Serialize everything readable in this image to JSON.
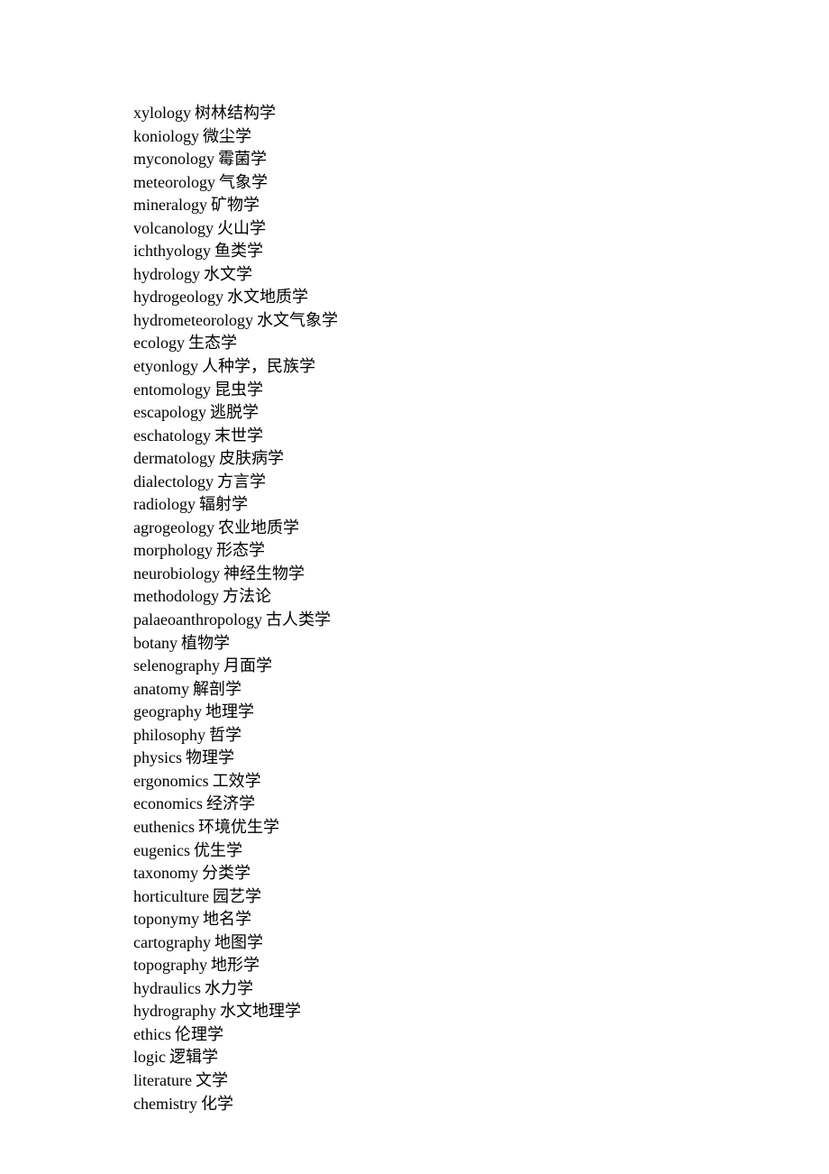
{
  "entries": [
    {
      "en": "xylology",
      "zh": "树林结构学"
    },
    {
      "en": "koniology",
      "zh": "微尘学"
    },
    {
      "en": "myconology",
      "zh": "霉菌学"
    },
    {
      "en": "meteorology",
      "zh": "气象学"
    },
    {
      "en": "mineralogy",
      "zh": "矿物学"
    },
    {
      "en": "volcanology",
      "zh": "火山学"
    },
    {
      "en": "ichthyology",
      "zh": "鱼类学"
    },
    {
      "en": "hydrology",
      "zh": "水文学"
    },
    {
      "en": "hydrogeology",
      "zh": "水文地质学"
    },
    {
      "en": "hydrometeorology",
      "zh": "水文气象学"
    },
    {
      "en": "ecology",
      "zh": "生态学"
    },
    {
      "en": "etyonlogy",
      "zh": "人种学，民族学"
    },
    {
      "en": "entomology",
      "zh": "昆虫学"
    },
    {
      "en": "escapology",
      "zh": "逃脱学"
    },
    {
      "en": "eschatology",
      "zh": "末世学"
    },
    {
      "en": "dermatology",
      "zh": "皮肤病学"
    },
    {
      "en": "dialectology",
      "zh": "方言学"
    },
    {
      "en": "radiology",
      "zh": "辐射学"
    },
    {
      "en": "agrogeology",
      "zh": "农业地质学"
    },
    {
      "en": "morphology",
      "zh": "形态学"
    },
    {
      "en": "neurobiology",
      "zh": "神经生物学"
    },
    {
      "en": "methodology",
      "zh": "方法论"
    },
    {
      "en": "palaeoanthropology",
      "zh": "古人类学"
    },
    {
      "en": "botany",
      "zh": "植物学"
    },
    {
      "en": "selenography",
      "zh": "月面学"
    },
    {
      "en": "anatomy",
      "zh": "解剖学"
    },
    {
      "en": "geography",
      "zh": "地理学"
    },
    {
      "en": "philosophy",
      "zh": "哲学"
    },
    {
      "en": "physics",
      "zh": "物理学"
    },
    {
      "en": "ergonomics",
      "zh": "工效学"
    },
    {
      "en": "economics",
      "zh": "经济学"
    },
    {
      "en": "euthenics",
      "zh": "环境优生学"
    },
    {
      "en": "eugenics",
      "zh": "优生学"
    },
    {
      "en": "taxonomy",
      "zh": "分类学"
    },
    {
      "en": "horticulture",
      "zh": "园艺学"
    },
    {
      "en": "toponymy",
      "zh": "地名学"
    },
    {
      "en": "cartography",
      "zh": "地图学"
    },
    {
      "en": "topography",
      "zh": "地形学"
    },
    {
      "en": "hydraulics",
      "zh": "水力学"
    },
    {
      "en": "hydrography",
      "zh": "水文地理学"
    },
    {
      "en": "ethics",
      "zh": "伦理学"
    },
    {
      "en": "logic",
      "zh": "逻辑学"
    },
    {
      "en": "literature",
      "zh": "文学"
    },
    {
      "en": "chemistry",
      "zh": "化学"
    }
  ]
}
